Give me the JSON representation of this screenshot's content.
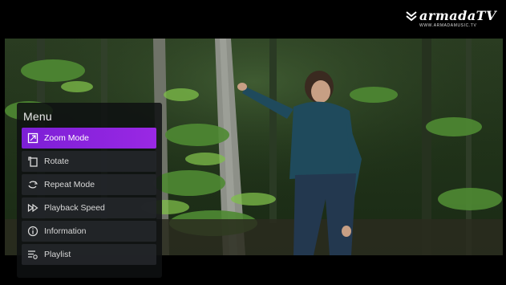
{
  "logo": {
    "text": "armadaTV",
    "url": "WWW.ARMADAMUSIC.TV"
  },
  "menu": {
    "title": "Menu",
    "items": [
      {
        "label": "Zoom Mode",
        "icon": "zoom-mode-icon",
        "active": true
      },
      {
        "label": "Rotate",
        "icon": "rotate-icon",
        "active": false
      },
      {
        "label": "Repeat Mode",
        "icon": "repeat-icon",
        "active": false
      },
      {
        "label": "Playback Speed",
        "icon": "playback-speed-icon",
        "active": false
      },
      {
        "label": "Information",
        "icon": "info-icon",
        "active": false
      },
      {
        "label": "Playlist",
        "icon": "playlist-icon",
        "active": false
      }
    ]
  },
  "colors": {
    "accent": "#8a24dd",
    "menu_bg": "#0e1012"
  }
}
